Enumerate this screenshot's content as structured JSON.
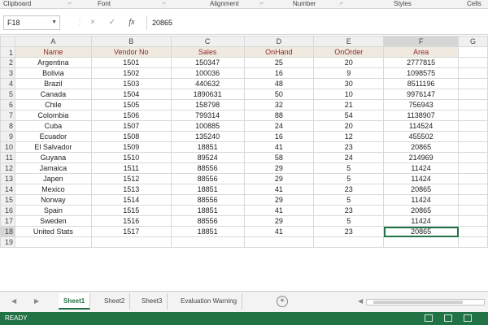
{
  "ribbon": {
    "groups": [
      "Clipboard",
      "Font",
      "Alignment",
      "Number",
      "Styles",
      "Cells"
    ]
  },
  "formula_bar": {
    "name_box": "F18",
    "cancel": "×",
    "enter": "✓",
    "fx": "fx",
    "value": "20865"
  },
  "grid": {
    "column_letters": [
      "A",
      "B",
      "C",
      "D",
      "E",
      "F",
      "G"
    ],
    "row_numbers": [
      "1",
      "2",
      "3",
      "4",
      "5",
      "6",
      "7",
      "8",
      "9",
      "10",
      "11",
      "12",
      "13",
      "14",
      "15",
      "16",
      "17",
      "18",
      "19"
    ],
    "headers": [
      "Name",
      "Vendor No",
      "Sales",
      "OnHand",
      "OnOrder",
      "Area"
    ],
    "rows": [
      [
        "Argentina",
        "1501",
        "150347",
        "25",
        "20",
        "2777815"
      ],
      [
        "Bolivia",
        "1502",
        "100036",
        "16",
        "9",
        "1098575"
      ],
      [
        "Brazil",
        "1503",
        "440632",
        "48",
        "30",
        "8511196"
      ],
      [
        "Canada",
        "1504",
        "1890631",
        "50",
        "10",
        "9976147"
      ],
      [
        "Chile",
        "1505",
        "158798",
        "32",
        "21",
        "756943"
      ],
      [
        "Colombia",
        "1506",
        "799314",
        "88",
        "54",
        "1138907"
      ],
      [
        "Cuba",
        "1507",
        "100885",
        "24",
        "20",
        "114524"
      ],
      [
        "Ecuador",
        "1508",
        "135240",
        "16",
        "12",
        "455502"
      ],
      [
        "El Salvador",
        "1509",
        "18851",
        "41",
        "23",
        "20865"
      ],
      [
        "Guyana",
        "1510",
        "89524",
        "58",
        "24",
        "214969"
      ],
      [
        "Jamaica",
        "1511",
        "88556",
        "29",
        "5",
        "11424"
      ],
      [
        "Japen",
        "1512",
        "88556",
        "29",
        "5",
        "11424"
      ],
      [
        "Mexico",
        "1513",
        "18851",
        "41",
        "23",
        "20865"
      ],
      [
        "Norway",
        "1514",
        "88556",
        "29",
        "5",
        "11424"
      ],
      [
        "Spain",
        "1515",
        "18851",
        "41",
        "23",
        "20865"
      ],
      [
        "Sweden",
        "1516",
        "88556",
        "29",
        "5",
        "11424"
      ],
      [
        "United Stats",
        "1517",
        "18851",
        "41",
        "23",
        "20865"
      ]
    ]
  },
  "sheets": {
    "tabs": [
      "Sheet1",
      "Sheet2",
      "Sheet3",
      "Evaluation Warning"
    ],
    "active": "Sheet1",
    "add": "+"
  },
  "status": {
    "text": "READY"
  },
  "colors": {
    "excel_green": "#217346",
    "header_text": "#8b2b2b",
    "header_fill": "#efe9df"
  }
}
